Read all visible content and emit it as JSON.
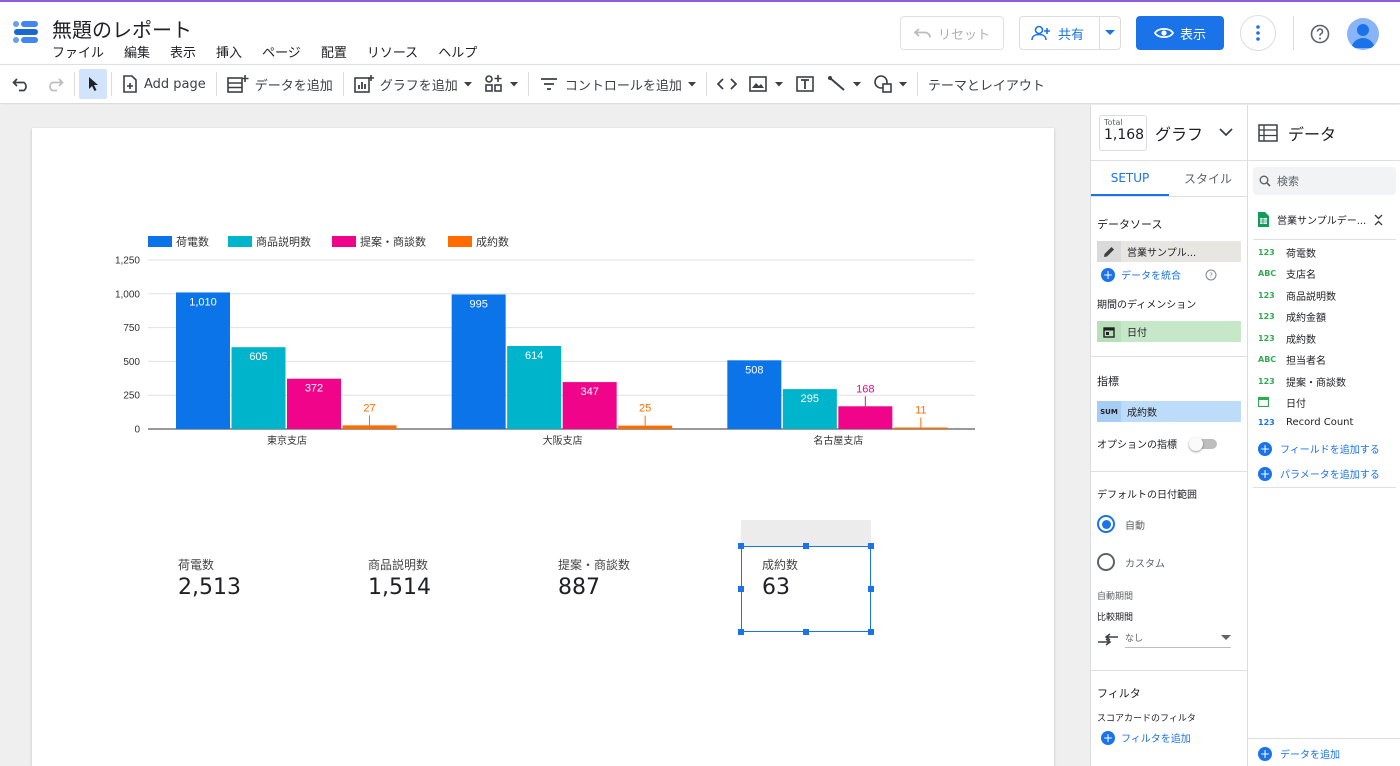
{
  "app": {
    "title": "無題のレポート",
    "menu": [
      "ファイル",
      "編集",
      "表示",
      "挿入",
      "ページ",
      "配置",
      "リソース",
      "ヘルプ"
    ],
    "reset_label": "リセット",
    "share_label": "共有",
    "view_label": "表示"
  },
  "toolbar": {
    "add_page": "Add page",
    "add_data": "データを追加",
    "add_chart": "グラフを追加",
    "add_control": "コントロールを追加",
    "theme_layout": "テーマとレイアウト"
  },
  "chart_data": {
    "type": "bar",
    "categories": [
      "東京支店",
      "大阪支店",
      "名古屋支店"
    ],
    "series": [
      {
        "name": "荷電数",
        "values": [
          1010,
          995,
          508
        ],
        "color": "#0b74e8"
      },
      {
        "name": "商品説明数",
        "values": [
          605,
          614,
          295
        ],
        "color": "#00b4cc"
      },
      {
        "name": "提案・商談数",
        "values": [
          372,
          347,
          168
        ],
        "color": "#f0058a"
      },
      {
        "name": "成約数",
        "values": [
          27,
          25,
          11
        ],
        "color": "#ff6d00"
      }
    ],
    "ylim": [
      0,
      1250
    ],
    "yticks": [
      "0",
      "250",
      "500",
      "750",
      "1,000",
      "1,250"
    ],
    "data_labels": [
      [
        "1,010",
        "995",
        "508"
      ],
      [
        "605",
        "614",
        "295"
      ],
      [
        "372",
        "347",
        "168"
      ],
      [
        "27",
        "25",
        "11"
      ]
    ],
    "legend": "top-left",
    "grid": true
  },
  "scorecards": [
    {
      "label": "荷電数",
      "value": "2,513"
    },
    {
      "label": "商品説明数",
      "value": "1,514"
    },
    {
      "label": "提案・商談数",
      "value": "887"
    },
    {
      "label": "成約数",
      "value": "63"
    }
  ],
  "props": {
    "total_label": "Total",
    "total_value": "1,168",
    "panel_title": "グラフ",
    "tab_setup": "SETUP",
    "tab_style": "スタイル",
    "datasource_title": "データソース",
    "datasource_name": "営業サンプル...",
    "blend_link": "データを統合",
    "period_dim_title": "期間のディメンション",
    "period_dim": "日付",
    "metric_title": "指標",
    "metric_agg": "SUM",
    "metric_name": "成約数",
    "optional_metric": "オプションの指標",
    "default_range_title": "デフォルトの日付範囲",
    "auto": "自動",
    "custom": "カスタム",
    "auto_period": "自動期間",
    "compare_period": "比較期間",
    "compare_value": "なし",
    "filter_title": "フィルタ",
    "scorecard_filter": "スコアカードのフィルタ",
    "add_filter": "フィルタを追加"
  },
  "data_panel": {
    "title": "データ",
    "search_placeholder": "検索",
    "source_name": "営業サンプルデー...",
    "fields": [
      {
        "type": "123",
        "name": "荷電数"
      },
      {
        "type": "ABC",
        "name": "支店名"
      },
      {
        "type": "123",
        "name": "商品説明数"
      },
      {
        "type": "123",
        "name": "成約金額"
      },
      {
        "type": "123",
        "name": "成約数"
      },
      {
        "type": "ABC",
        "name": "担当者名"
      },
      {
        "type": "123",
        "name": "提案・商談数"
      },
      {
        "type": "date",
        "name": "日付"
      },
      {
        "type": "123",
        "name": "Record Count"
      }
    ],
    "add_field": "フィールドを追加する",
    "add_param": "パラメータを追加する",
    "add_data": "データを追加"
  }
}
